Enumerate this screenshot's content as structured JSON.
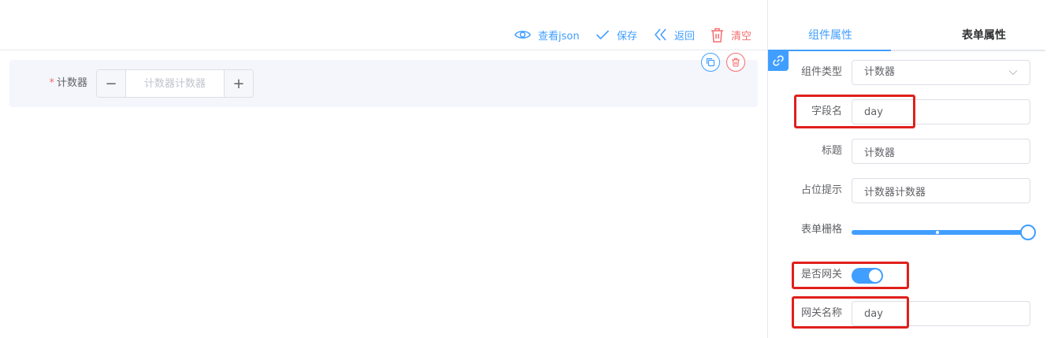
{
  "toolbar": {
    "view_json_label": "查看json",
    "save_label": "保存",
    "back_label": "返回",
    "clear_label": "清空"
  },
  "canvas": {
    "field": {
      "required_mark": "*",
      "label": "计数器",
      "placeholder": "计数器计数器",
      "value": "",
      "minus_symbol": "−",
      "plus_symbol": "+"
    }
  },
  "panel": {
    "tabs": [
      {
        "label": "组件属性",
        "active": true
      },
      {
        "label": "表单属性",
        "active": false
      }
    ],
    "properties": {
      "component_type": {
        "label": "组件类型",
        "value": "计数器"
      },
      "field_name": {
        "label": "字段名",
        "value": "day"
      },
      "title": {
        "label": "标题",
        "value": "计数器"
      },
      "placeholder": {
        "label": "占位提示",
        "value": "计数器计数器"
      },
      "form_grid": {
        "label": "表单栅格",
        "value_fraction": 1.0
      },
      "is_gateway": {
        "label": "是否网关",
        "value": true
      },
      "gateway_name": {
        "label": "网关名称",
        "value": "day"
      }
    }
  },
  "icons": {
    "view_json": "eye-icon",
    "save": "check-icon",
    "back": "double-chevron-left-icon",
    "clear": "trash-icon",
    "copy": "copy-icon",
    "delete": "trash-icon",
    "link": "link-icon",
    "select": "chevron-down-icon"
  },
  "colors": {
    "primary": "#409eff",
    "danger": "#f56c6c",
    "highlight": "#e0201b",
    "canvas_bg": "#f4f6fc"
  }
}
